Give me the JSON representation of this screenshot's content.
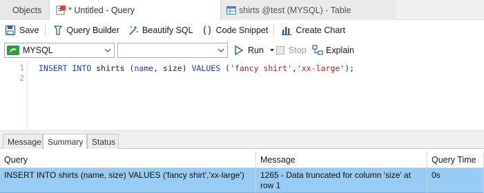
{
  "tabs": {
    "objects": "Objects",
    "query": "* Untitled - Query",
    "table": "shirts @test (MYSQL) - Table"
  },
  "toolbar": {
    "save": "Save",
    "query_builder": "Query Builder",
    "beautify": "Beautify SQL",
    "snippet": "Code Snippet",
    "chart": "Create Chart"
  },
  "connection": {
    "selected": "MYSQL",
    "database": "",
    "run": "Run",
    "stop": "Stop",
    "explain": "Explain"
  },
  "editor": {
    "line_numbers": [
      "1",
      "2"
    ],
    "line1": {
      "kw1": "INSERT INTO",
      "t1": " shirts (",
      "kw2": "name",
      "t2": ", size) ",
      "kw3": "VALUES",
      "t3": " (",
      "s1": "'fancy shirt'",
      "t4": ",",
      "s2": "'xx-large'",
      "t5": ");"
    }
  },
  "result_tabs": [
    "Message",
    "Summary",
    "Status"
  ],
  "grid": {
    "headers": [
      "Query",
      "Message",
      "Query Time"
    ],
    "rows": [
      {
        "query": "INSERT INTO shirts (name, size) VALUES ('fancy shirt','xx-large')",
        "message": "1265 - Data truncated for column 'size' at row 1",
        "time": "0s"
      }
    ]
  },
  "colors": {
    "selected_row": "#98ccf5",
    "keyword": "#1f3fb5",
    "string": "#b01f1f",
    "connection_icon": "#2e9e3c"
  }
}
